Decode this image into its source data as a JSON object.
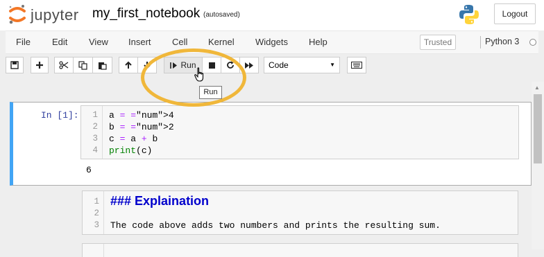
{
  "header": {
    "logo_text": "jupyter",
    "notebook_name": "my_first_notebook",
    "save_status": "(autosaved)",
    "logout_label": "Logout"
  },
  "menu": {
    "items": [
      "File",
      "Edit",
      "View",
      "Insert",
      "Cell",
      "Kernel",
      "Widgets",
      "Help"
    ],
    "trusted_label": "Trusted",
    "kernel_name": "Python 3"
  },
  "toolbar": {
    "run_label": "Run",
    "cell_type": "Code",
    "tooltip": "Run"
  },
  "cells": {
    "code_cell": {
      "prompt": "In [1]:",
      "line_numbers": [
        "1",
        "2",
        "3",
        "4"
      ],
      "lines": [
        "a = 4",
        "b = 2",
        "c = a + b",
        "print(c)"
      ],
      "output": "6"
    },
    "markdown_cell": {
      "line_numbers": [
        "1",
        "2",
        "3"
      ],
      "heading": "### Explaination",
      "text": "The code above adds two numbers and prints the resulting sum."
    },
    "next_cell": {
      "line_numbers": [
        "1"
      ]
    }
  },
  "colors": {
    "accent_ring": "#f0b73a",
    "selected_cell_border": "#42a5f5",
    "prompt_color": "#303f9f",
    "markdown_heading": "#0000cc"
  },
  "icons": [
    "jupyter-logo",
    "python-logo",
    "save-icon",
    "plus-icon",
    "cut-icon",
    "copy-icon",
    "paste-icon",
    "arrow-up-icon",
    "arrow-down-icon",
    "run-icon",
    "stop-icon",
    "restart-icon",
    "fast-forward-icon",
    "keyboard-icon",
    "kernel-idle-icon",
    "cursor-hand-icon"
  ]
}
